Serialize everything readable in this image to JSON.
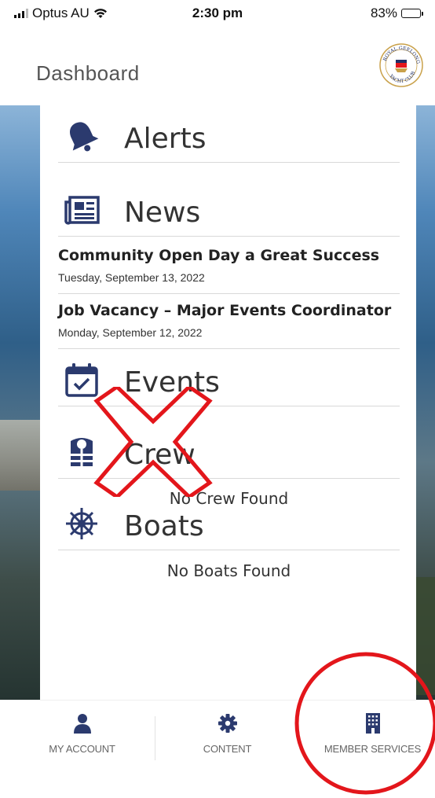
{
  "status_bar": {
    "carrier": "Optus AU",
    "time": "2:30 pm",
    "battery": "83%",
    "battery_level": 0.83
  },
  "header": {
    "title": "Dashboard",
    "logo_text_top": "ROYAL GEELONG",
    "logo_text_bottom": "YACHT CLUB"
  },
  "sections": {
    "alerts": {
      "label": "Alerts",
      "icon": "bell-icon"
    },
    "news": {
      "label": "News",
      "icon": "newspaper-icon",
      "items": [
        {
          "title": "Community Open Day a Great Success",
          "date": "Tuesday, September 13, 2022"
        },
        {
          "title": "Job Vacancy – Major Events Coordinator",
          "date": "Monday, September 12, 2022"
        }
      ]
    },
    "events": {
      "label": "Events",
      "icon": "calendar-check-icon"
    },
    "crew": {
      "label": "Crew",
      "icon": "life-vest-icon",
      "empty": "No Crew Found"
    },
    "boats": {
      "label": "Boats",
      "icon": "ship-wheel-icon",
      "empty": "No Boats Found"
    }
  },
  "tab_bar": {
    "tabs": [
      {
        "label": "MY ACCOUNT",
        "icon": "user-icon"
      },
      {
        "label": "CONTENT",
        "icon": "gear-icon"
      },
      {
        "label": "MEMBER SERVICES",
        "icon": "building-icon"
      }
    ]
  },
  "colors": {
    "accent": "#2b3a6e",
    "annotation": "#e3161b"
  }
}
